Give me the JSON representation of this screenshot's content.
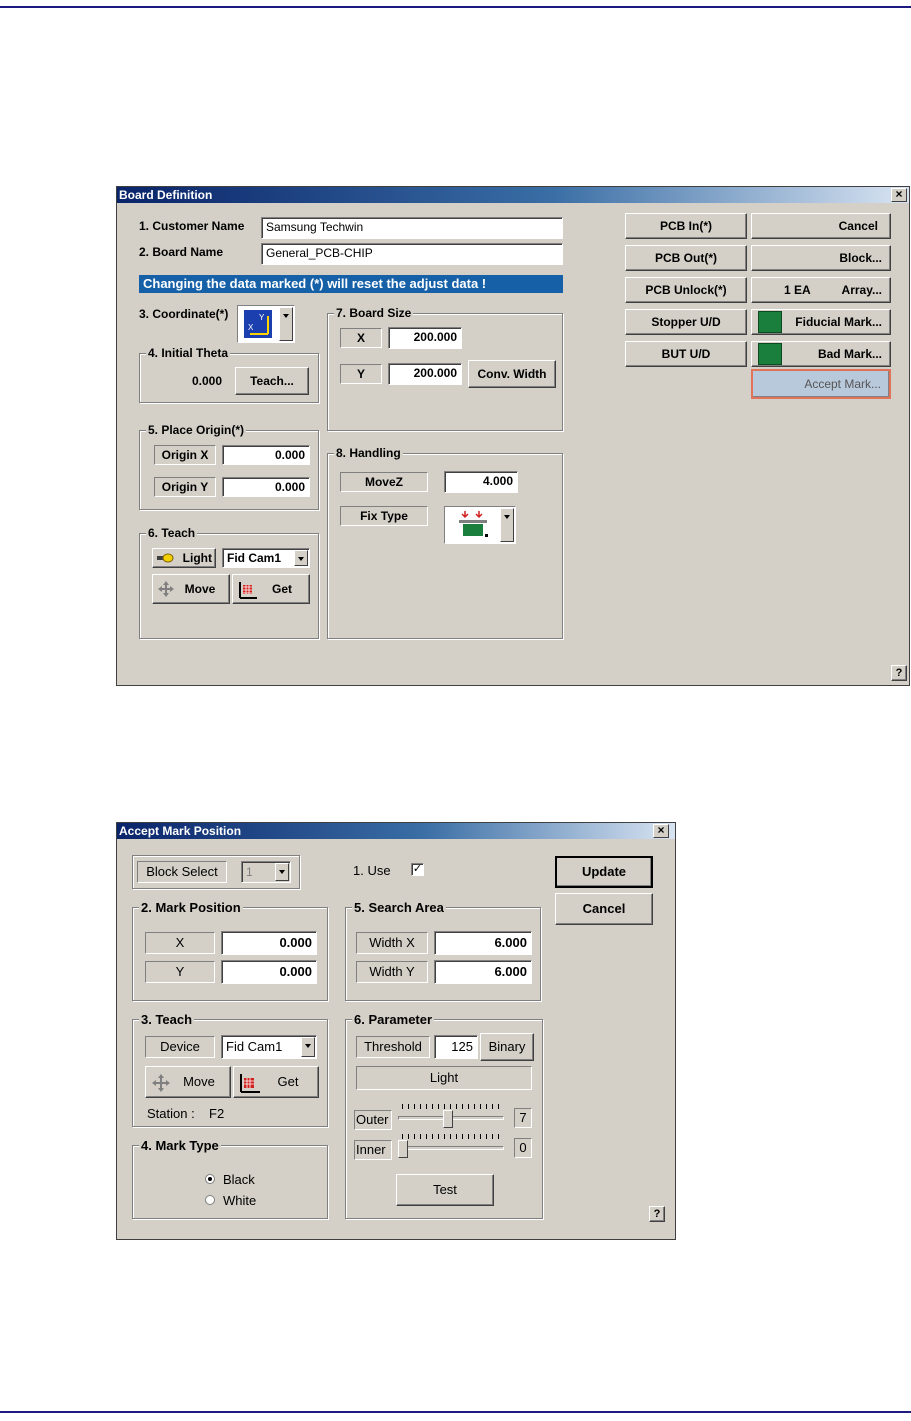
{
  "board_definition": {
    "title": "Board Definition",
    "customer_name_label": "1. Customer Name",
    "customer_name_value": "Samsung Techwin",
    "board_name_label": "2. Board Name",
    "board_name_value": "General_PCB-CHIP",
    "warning": "Changing the data marked (*) will reset the adjust data !",
    "coordinate_label": "3. Coordinate(*)",
    "initial_theta": {
      "title": "4. Initial Theta",
      "value": "0.000",
      "teach_label": "Teach..."
    },
    "place_origin": {
      "title": "5. Place Origin(*)",
      "x_label": "Origin X",
      "x_value": "0.000",
      "y_label": "Origin Y",
      "y_value": "0.000"
    },
    "teach": {
      "title": "6. Teach",
      "light_label": "Light",
      "camera": "Fid Cam1",
      "move_label": "Move",
      "get_label": "Get"
    },
    "board_size": {
      "title": "7. Board Size",
      "x_label": "X",
      "x_value": "200.000",
      "y_label": "Y",
      "y_value": "200.000",
      "conv_width_label": "Conv. Width"
    },
    "handling": {
      "title": "8. Handling",
      "movez_label": "MoveZ",
      "movez_value": "4.000",
      "fix_type_label": "Fix Type"
    },
    "buttons": {
      "pcb_in": "PCB In(*)",
      "cancel": "Cancel",
      "pcb_out": "PCB Out(*)",
      "block": "Block...",
      "pcb_unlock": "PCB Unlock(*)",
      "array_count": "1 EA",
      "array": "Array...",
      "stopper": "Stopper U/D",
      "fiducial": "Fiducial Mark...",
      "but": "BUT U/D",
      "bad_mark": "Bad Mark...",
      "accept_mark": "Accept Mark..."
    },
    "help": "?",
    "close": "×"
  },
  "accept_mark": {
    "title": "Accept Mark Position",
    "block_select_label": "Block Select",
    "block_select_value": "1",
    "use_label": "1. Use",
    "use_checked": "✓",
    "update_label": "Update",
    "cancel_label": "Cancel",
    "mark_position": {
      "title": "2. Mark Position",
      "x_label": "X",
      "x_value": "0.000",
      "y_label": "Y",
      "y_value": "0.000"
    },
    "search_area": {
      "title": "5. Search Area",
      "wx_label": "Width X",
      "wx_value": "6.000",
      "wy_label": "Width Y",
      "wy_value": "6.000"
    },
    "teach": {
      "title": "3. Teach",
      "device_label": "Device",
      "device_value": "Fid Cam1",
      "move_label": "Move",
      "get_label": "Get",
      "station_label": "Station :",
      "station_value": "F2"
    },
    "parameter": {
      "title": "6. Parameter",
      "threshold_label": "Threshold",
      "threshold_value": "125",
      "binary_label": "Binary",
      "light_label": "Light",
      "outer_label": "Outer",
      "outer_value": "7",
      "outer_level": 0.47,
      "inner_label": "Inner",
      "inner_value": "0",
      "inner_level": 0.0,
      "test_label": "Test"
    },
    "mark_type": {
      "title": "4. Mark Type",
      "black_label": "Black",
      "white_label": "White",
      "selected": "Black"
    },
    "help": "?",
    "close": "×"
  }
}
